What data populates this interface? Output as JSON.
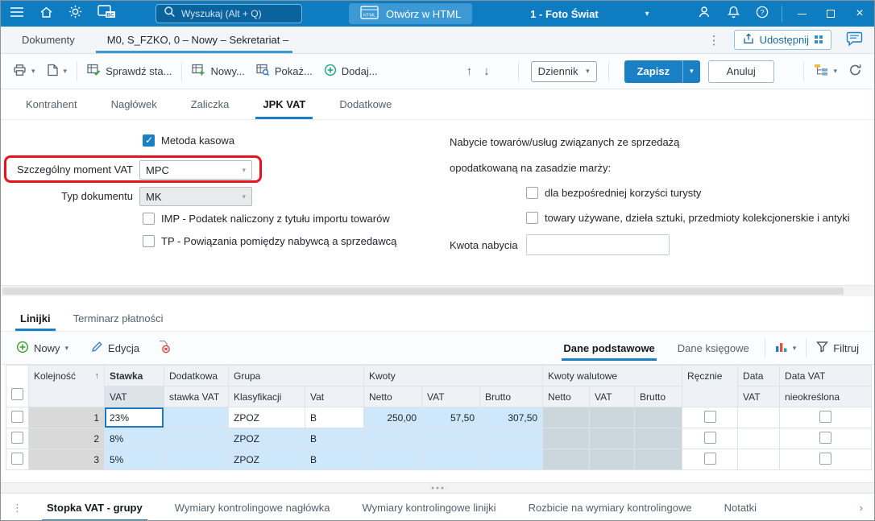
{
  "topbar": {
    "search_placeholder": "Wyszukaj (Alt + Q)",
    "open_html": "Otwórz w HTML",
    "company": "1 - Foto Świat"
  },
  "tabrow": {
    "documents_tab": "Dokumenty",
    "active_tab": "M0, S_FZKO, 0 – Nowy – Sekretariat – ...",
    "share": "Udostępnij"
  },
  "toolbar": {
    "check_status": "Sprawdź sta...",
    "new_doc": "Nowy...",
    "show": "Pokaż...",
    "add": "Dodaj...",
    "journal": "Dziennik",
    "save": "Zapisz",
    "cancel": "Anuluj"
  },
  "form_tabs": [
    "Kontrahent",
    "Nagłówek",
    "Zaliczka",
    "JPK VAT",
    "Dodatkowe"
  ],
  "form": {
    "metoda_kasowa": "Metoda kasowa",
    "szczegolny_moment_label": "Szczególny moment VAT",
    "szczegolny_moment_value": "MPC",
    "typ_dokumentu_label": "Typ dokumentu",
    "typ_dokumentu_value": "MK",
    "imp": "IMP - Podatek naliczony z tytułu importu towarów",
    "tp": "TP - Powiązania pomiędzy nabywcą a sprzedawcą",
    "nabycie_line1": "Nabycie towarów/usług związanych ze sprzedażą",
    "nabycie_line2": "opodatkowaną na zasadzie marży:",
    "turysta": "dla bezpośredniej korzyści turysty",
    "towary": "towary używane, dzieła sztuki, przedmioty kolekcjonerskie i antyki",
    "kwota_nabycia_label": "Kwota nabycia",
    "kwota_nabycia_value": ""
  },
  "lines": {
    "tab_linijki": "Linijki",
    "tab_terminarz": "Terminarz płatności",
    "new": "Nowy",
    "edit": "Edycja",
    "dane_podstawowe": "Dane podstawowe",
    "dane_ksiegowe": "Dane księgowe",
    "filter": "Filtruj"
  },
  "table": {
    "headers": {
      "kolejnosc": "Kolejność",
      "stawka": "Stawka",
      "stawka_sub": "VAT",
      "dodatkowa": "Dodatkowa",
      "dodatkowa_sub": "stawka VAT",
      "grupa": "Grupa",
      "grupa_sub": "Klasyfikacji",
      "vat_sub": "Vat",
      "kwoty": "Kwoty",
      "netto": "Netto",
      "vat": "VAT",
      "brutto": "Brutto",
      "kwoty_walutowe": "Kwoty walutowe",
      "w_netto": "Netto",
      "w_vat": "VAT",
      "w_brutto": "Brutto",
      "recznie": "Ręcznie",
      "data": "Data",
      "data_sub": "VAT",
      "data_vat": "Data VAT",
      "data_vat_sub": "nieokreślona"
    },
    "rows": [
      {
        "kolejnosc": "1",
        "stawka": "23%",
        "grupa": "ZPOZ",
        "vat": "B",
        "netto": "250,00",
        "vat_kwota": "57,50",
        "brutto": "307,50"
      },
      {
        "kolejnosc": "2",
        "stawka": "8%",
        "grupa": "ZPOZ",
        "vat": "B",
        "netto": "",
        "vat_kwota": "",
        "brutto": ""
      },
      {
        "kolejnosc": "3",
        "stawka": "5%",
        "grupa": "ZPOZ",
        "vat": "B",
        "netto": "",
        "vat_kwota": "",
        "brutto": ""
      }
    ]
  },
  "bottom_tabs": {
    "items": [
      "Stopka VAT - grupy",
      "Wymiary kontrolingowe nagłówka",
      "Wymiary kontrolingowe linijki",
      "Rozbicie na wymiary kontrolingowe",
      "Notatki"
    ]
  }
}
